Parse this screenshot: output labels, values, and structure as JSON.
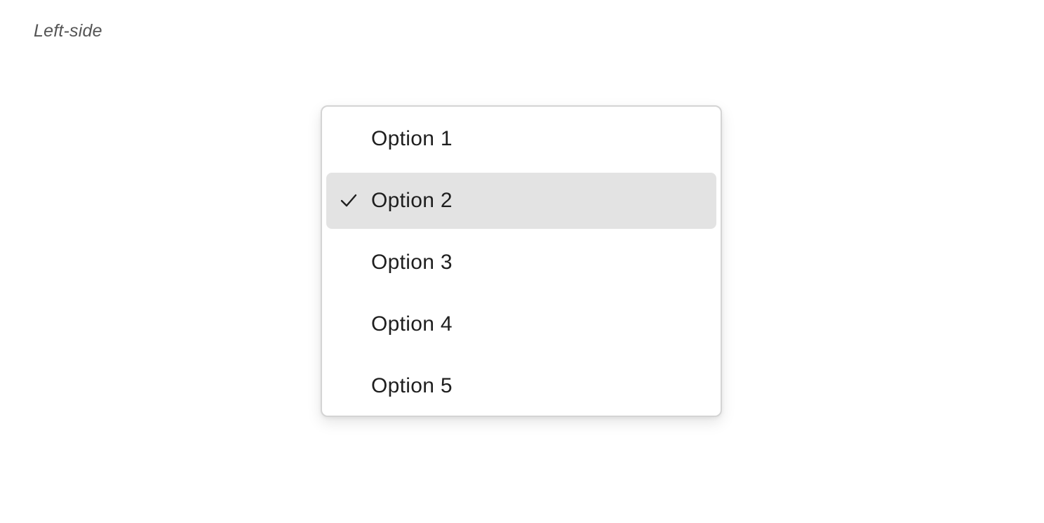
{
  "header": {
    "label": "Left-side"
  },
  "listbox": {
    "selected_index": 1,
    "options": [
      {
        "label": "Option 1",
        "selected": false
      },
      {
        "label": "Option 2",
        "selected": true
      },
      {
        "label": "Option 3",
        "selected": false
      },
      {
        "label": "Option 4",
        "selected": false
      },
      {
        "label": "Option 5",
        "selected": false
      }
    ],
    "check_icon": "checkmark-icon",
    "colors": {
      "selected_background": "#e3e3e3",
      "border": "#d4d4d4",
      "text": "#1f1f1f"
    }
  }
}
